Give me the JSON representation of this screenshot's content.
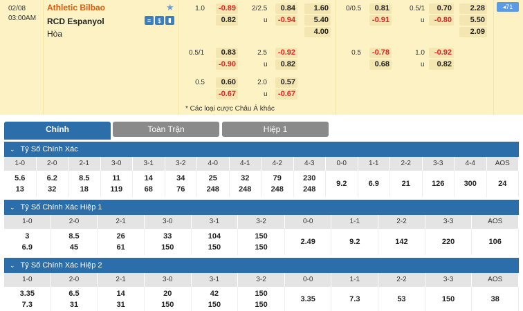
{
  "match": {
    "date": "02/08",
    "time": "03:00AM",
    "home": "Athletic Bilbao",
    "away": "RCD Espanyol",
    "draw": "Hòa",
    "badge": "◂71",
    "more_link": "* Các loại cược Châu Á khác",
    "icons": [
      "stats-icon",
      "dollar-icon",
      "chart-icon"
    ],
    "ft_handicap_lines": [
      {
        "line": "1.0",
        "home": "-0.89",
        "away": "0.82"
      },
      {
        "line": "0.5/1",
        "home": "0.83",
        "away": "-0.90"
      },
      {
        "line": "0.5",
        "home": "0.60",
        "away": "-0.67"
      }
    ],
    "ft_ou_lines": [
      {
        "line": "2/2.5",
        "over": "0.84",
        "under": "-0.94"
      },
      {
        "line": "2.5",
        "over": "-0.92",
        "under": "0.82"
      },
      {
        "line": "2.0",
        "over": "0.57",
        "under": "-0.67"
      }
    ],
    "ft_1x2": [
      "1.60",
      "5.40",
      "4.00"
    ],
    "h1_handicap_lines": [
      {
        "line": "0/0.5",
        "home": "0.81",
        "away": "-0.91"
      },
      {
        "line": "0.5",
        "home": "-0.78",
        "away": "0.68"
      }
    ],
    "h1_ou_lines": [
      {
        "line": "0.5/1",
        "over": "0.70",
        "under": "-0.80"
      },
      {
        "line": "1.0",
        "over": "-0.92",
        "under": "0.82"
      }
    ],
    "h1_1x2": [
      "2.28",
      "5.50",
      "2.09"
    ],
    "under_label": "u"
  },
  "tabs": [
    "Chính",
    "Toàn Trận",
    "Hiệp 1"
  ],
  "sections": [
    {
      "title": "Tỷ Số Chính Xác",
      "headers": [
        "1-0",
        "2-0",
        "2-1",
        "3-0",
        "3-1",
        "3-2",
        "4-0",
        "4-1",
        "4-2",
        "4-3",
        "0-0",
        "1-1",
        "2-2",
        "3-3",
        "4-4",
        "AOS"
      ],
      "values": [
        [
          "5.6",
          "13"
        ],
        [
          "6.2",
          "32"
        ],
        [
          "8.5",
          "18"
        ],
        [
          "11",
          "119"
        ],
        [
          "14",
          "68"
        ],
        [
          "34",
          "76"
        ],
        [
          "25",
          "248"
        ],
        [
          "32",
          "248"
        ],
        [
          "79",
          "248"
        ],
        [
          "230",
          "248"
        ],
        [
          "9.2"
        ],
        [
          "6.9"
        ],
        [
          "21"
        ],
        [
          "126"
        ],
        [
          "300"
        ],
        [
          "24"
        ]
      ]
    },
    {
      "title": "Tỷ Số Chính Xác Hiệp 1",
      "headers": [
        "1-0",
        "2-0",
        "2-1",
        "3-0",
        "3-1",
        "3-2",
        "0-0",
        "1-1",
        "2-2",
        "3-3",
        "AOS"
      ],
      "values": [
        [
          "3",
          "6.9"
        ],
        [
          "8.5",
          "45"
        ],
        [
          "26",
          "61"
        ],
        [
          "33",
          "150"
        ],
        [
          "104",
          "150"
        ],
        [
          "150",
          "150"
        ],
        [
          "2.49"
        ],
        [
          "9.2"
        ],
        [
          "142"
        ],
        [
          "220"
        ],
        [
          "106"
        ]
      ]
    },
    {
      "title": "Tỷ Số Chính Xác Hiệp 2",
      "headers": [
        "1-0",
        "2-0",
        "2-1",
        "3-0",
        "3-1",
        "3-2",
        "0-0",
        "1-1",
        "2-2",
        "3-3",
        "AOS"
      ],
      "values": [
        [
          "3.35",
          "7.3"
        ],
        [
          "6.5",
          "31"
        ],
        [
          "14",
          "31"
        ],
        [
          "20",
          "150"
        ],
        [
          "42",
          "150"
        ],
        [
          "150",
          "150"
        ],
        [
          "3.35"
        ],
        [
          "7.3"
        ],
        [
          "53"
        ],
        [
          "150"
        ],
        [
          "38"
        ]
      ]
    }
  ]
}
